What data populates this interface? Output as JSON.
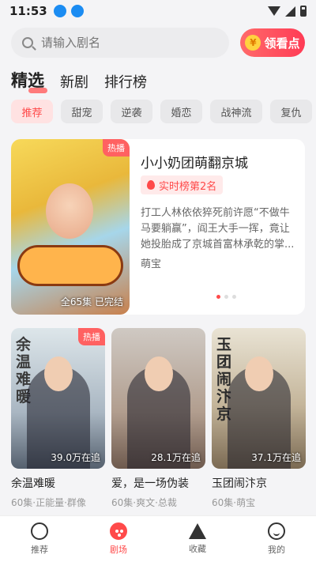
{
  "status": {
    "time": "11:53"
  },
  "search": {
    "placeholder": "请输入剧名"
  },
  "coin_button": {
    "label": "领看点",
    "coin_symbol": "¥"
  },
  "tabs": [
    {
      "label": "精选",
      "active": true
    },
    {
      "label": "新剧",
      "active": false
    },
    {
      "label": "排行榜",
      "active": false
    }
  ],
  "chips": [
    {
      "label": "推荐",
      "active": true
    },
    {
      "label": "甜宠"
    },
    {
      "label": "逆袭"
    },
    {
      "label": "婚恋"
    },
    {
      "label": "战神流"
    },
    {
      "label": "复仇"
    }
  ],
  "featured": {
    "title": "小小奶团萌翻京城",
    "rank": "实时榜第2名",
    "description": "打工人林依依猝死前许愿“不做牛马要躺赢”，阎王大手一挥，竟让她投胎成了京城首富林承乾的掌...",
    "tag": "萌宝",
    "badge": "热播",
    "meta": "全65集  已完结",
    "carousel_active_index": 0,
    "carousel_count": 3
  },
  "cards": [
    {
      "title": "余温难暖",
      "subtitle": "60集·正能量·群像",
      "count": "39.0万在追",
      "badge": "热播",
      "cover_text": "余温难暖"
    },
    {
      "title": "爱，是一场伪装",
      "subtitle": "60集·爽文·总裁",
      "count": "28.1万在追",
      "badge": "",
      "cover_text": ""
    },
    {
      "title": "玉团闹汴京",
      "subtitle": "60集·萌宝",
      "count": "37.1万在追",
      "badge": "",
      "cover_text": "玉团闹汴京"
    }
  ],
  "bottom_nav": [
    {
      "label": "推荐",
      "icon": "recommend-icon"
    },
    {
      "label": "剧场",
      "icon": "theater-icon",
      "active": true
    },
    {
      "label": "收藏",
      "icon": "star-icon"
    },
    {
      "label": "我的",
      "icon": "smile-icon"
    }
  ],
  "colors": {
    "accent": "#ff4a4a",
    "chip_active_bg": "#ffe2e2",
    "background": "#f4f4f6"
  }
}
